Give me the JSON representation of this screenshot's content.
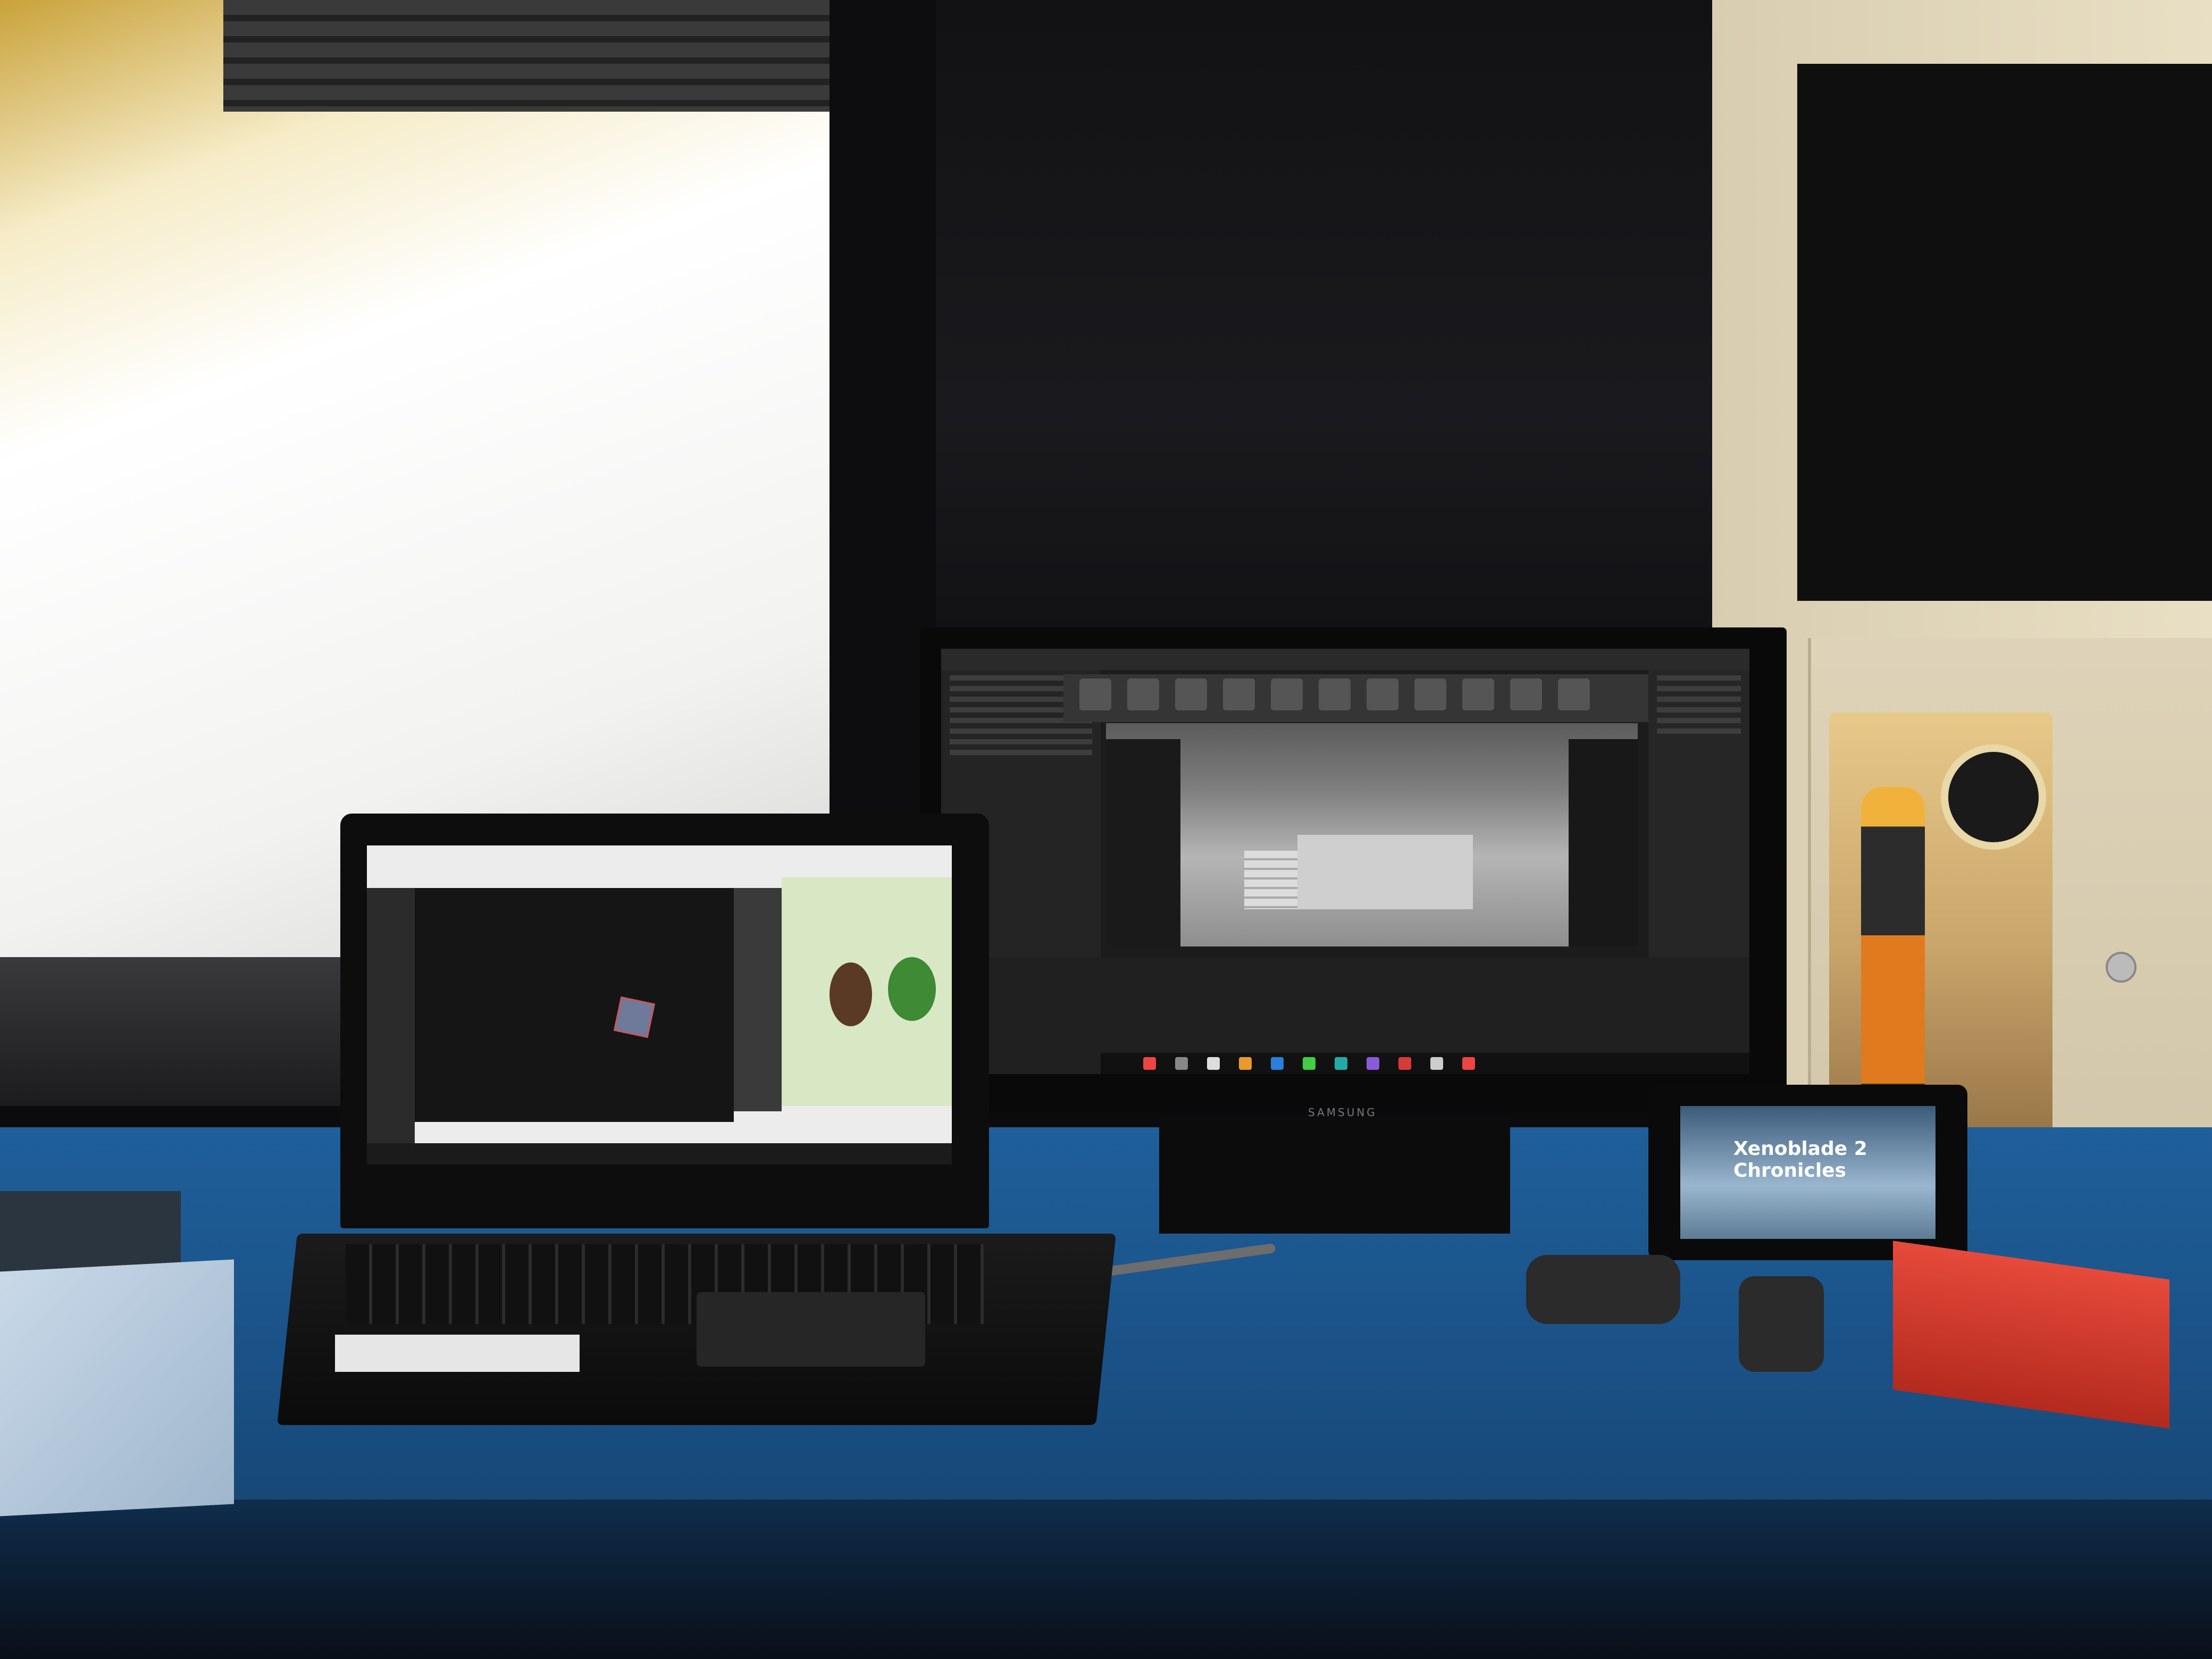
{
  "scene": {
    "description_tags": []
  },
  "monitor": {
    "brand": "SAMSUNG"
  },
  "switch": {
    "game_title": "Xenoblade 2 Chronicles"
  },
  "colors": {
    "desk": "#1f5f9a",
    "wall": "#121214",
    "window_light": "#f6ecc8",
    "games_red": "#e64a3a"
  }
}
